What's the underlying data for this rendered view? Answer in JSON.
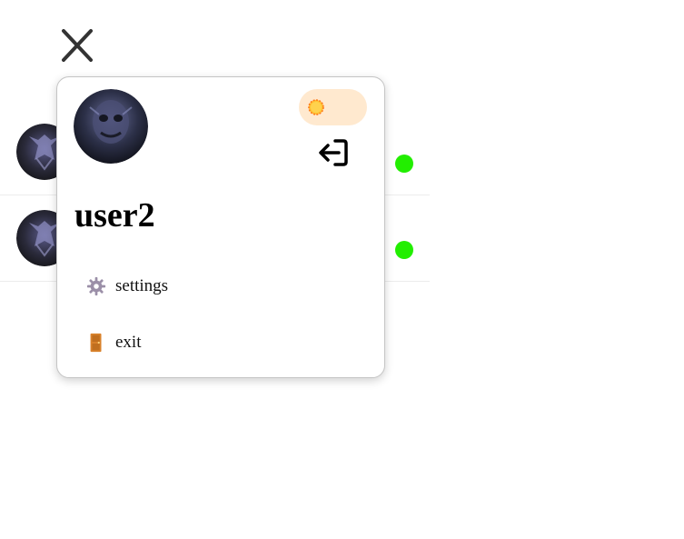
{
  "colors": {
    "online": "#22ee00",
    "toggle_bg": "#ffe9cf",
    "sun": "#ffb300",
    "popup_border": "#c4c4c4"
  },
  "icons": {
    "close": "close-icon",
    "sun": "sun-icon",
    "logout": "logout-icon",
    "settings": "gear-icon",
    "exit": "door-icon"
  },
  "chat_list": {
    "rows": [
      {
        "online": true
      },
      {
        "online": true
      }
    ]
  },
  "profile": {
    "username": "user2",
    "theme": "light",
    "menu": {
      "settings_label": "settings",
      "exit_label": "exit"
    }
  }
}
